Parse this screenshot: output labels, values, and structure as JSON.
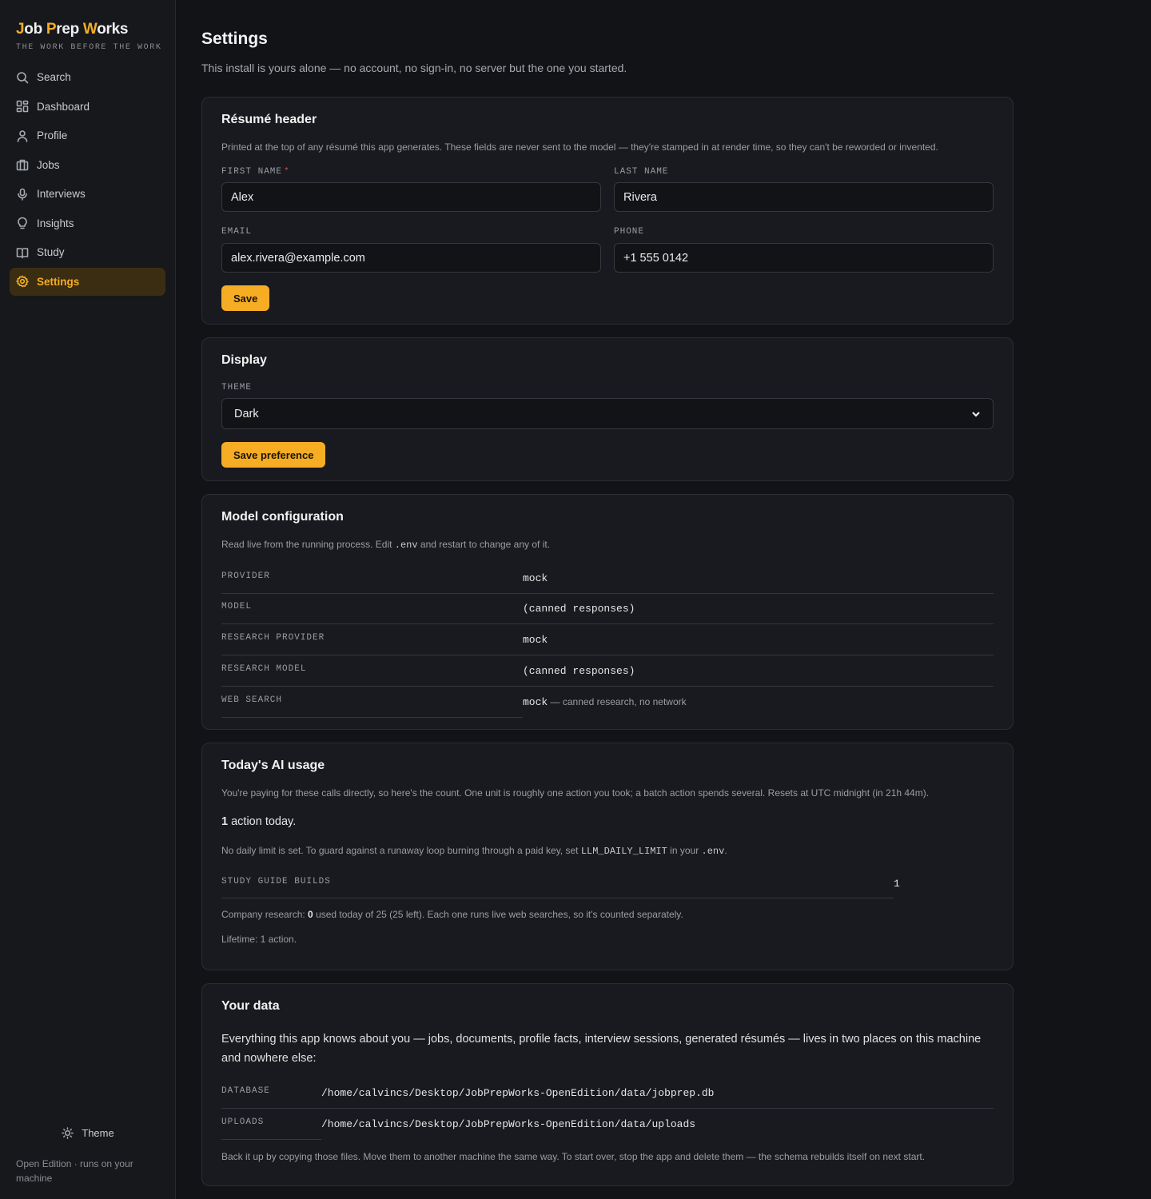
{
  "brand": {
    "title_parts": [
      "J",
      "ob ",
      "P",
      "rep ",
      "W",
      "orks"
    ],
    "tagline": "THE WORK BEFORE THE WORK"
  },
  "nav": [
    {
      "label": "Search",
      "icon": "search-icon"
    },
    {
      "label": "Dashboard",
      "icon": "dashboard-icon"
    },
    {
      "label": "Profile",
      "icon": "user-icon"
    },
    {
      "label": "Jobs",
      "icon": "briefcase-icon"
    },
    {
      "label": "Interviews",
      "icon": "microphone-icon"
    },
    {
      "label": "Insights",
      "icon": "lightbulb-icon"
    },
    {
      "label": "Study",
      "icon": "book-icon"
    },
    {
      "label": "Settings",
      "icon": "gear-icon",
      "active": true
    }
  ],
  "sidebar_footer": {
    "theme_label": "Theme",
    "edition_note": "Open Edition · runs on your machine"
  },
  "colors": {
    "accent": "#f6ad24",
    "background": "#111317",
    "card": "#181a1f",
    "required": "#e5484d"
  },
  "page": {
    "title": "Settings",
    "subtitle": "This install is yours alone — no account, no sign-in, no server but the one you started."
  },
  "resume_header": {
    "title": "Résumé header",
    "description": "Printed at the top of any résumé this app generates. These fields are never sent to the model — they're stamped in at render time, so they can't be reworded or invented.",
    "first_name_label": "FIRST NAME",
    "first_name_required": "*",
    "first_name_value": "Alex",
    "last_name_label": "LAST NAME",
    "last_name_value": "Rivera",
    "email_label": "EMAIL",
    "email_value": "alex.rivera@example.com",
    "phone_label": "PHONE",
    "phone_value": "+1 555 0142",
    "save_label": "Save"
  },
  "display": {
    "title": "Display",
    "theme_label": "THEME",
    "theme_value": "Dark",
    "save_label": "Save preference"
  },
  "model_config": {
    "title": "Model configuration",
    "description_pre": "Read live from the running process. Edit ",
    "description_code": ".env",
    "description_post": " and restart to change any of it.",
    "rows": [
      {
        "key": "PROVIDER",
        "value": "mock",
        "note": ""
      },
      {
        "key": "MODEL",
        "value": "(canned responses)",
        "note": ""
      },
      {
        "key": "RESEARCH PROVIDER",
        "value": "mock",
        "note": ""
      },
      {
        "key": "RESEARCH MODEL",
        "value": "(canned responses)",
        "note": ""
      },
      {
        "key": "WEB SEARCH",
        "value": "mock",
        "note": " — canned research, no network"
      }
    ]
  },
  "usage": {
    "title": "Today's AI usage",
    "description": "You're paying for these calls directly, so here's the count. One unit is roughly one action you took; a batch action spends several. Resets at UTC midnight (in 21h 44m).",
    "count": "1",
    "count_suffix": " action today.",
    "limit_pre": "No daily limit is set. To guard against a runaway loop burning through a paid key, set ",
    "limit_code": "LLM_DAILY_LIMIT",
    "limit_mid": " in your ",
    "limit_code2": ".env",
    "limit_post": ".",
    "breakdown_key": "STUDY GUIDE BUILDS",
    "breakdown_value": "1",
    "research_pre": "Company research: ",
    "research_count": "0",
    "research_post": " used today of 25 (25 left). Each one runs live web searches, so it's counted separately.",
    "lifetime": "Lifetime: 1 action."
  },
  "your_data": {
    "title": "Your data",
    "intro": "Everything this app knows about you — jobs, documents, profile facts, interview sessions, generated résumés — lives in two places on this machine and nowhere else:",
    "database_label": "DATABASE",
    "database_path": "/home/calvincs/Desktop/JobPrepWorks-OpenEdition/data/jobprep.db",
    "uploads_label": "UPLOADS",
    "uploads_path": "/home/calvincs/Desktop/JobPrepWorks-OpenEdition/data/uploads",
    "footer": "Back it up by copying those files. Move them to another machine the same way. To start over, stop the app and delete them — the schema rebuilds itself on next start."
  }
}
